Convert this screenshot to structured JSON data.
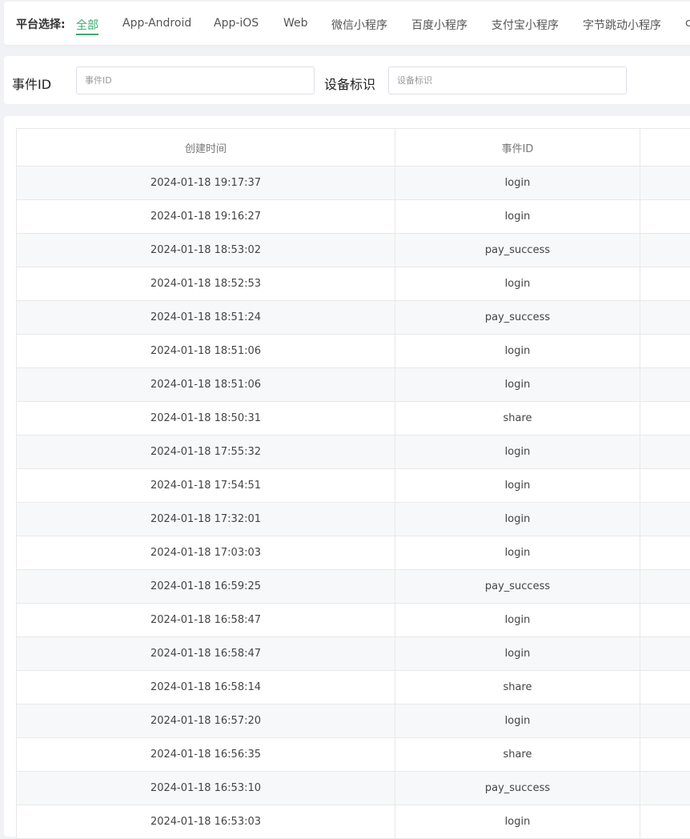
{
  "platform": {
    "label": "平台选择:",
    "tabs": [
      {
        "label": "全部",
        "active": true
      },
      {
        "label": "App-Android",
        "active": false
      },
      {
        "label": "App-iOS",
        "active": false
      },
      {
        "label": "Web",
        "active": false
      },
      {
        "label": "微信小程序",
        "active": false
      },
      {
        "label": "百度小程序",
        "active": false
      },
      {
        "label": "支付宝小程序",
        "active": false
      },
      {
        "label": "字节跳动小程序",
        "active": false
      },
      {
        "label": "c",
        "active": false
      }
    ],
    "accent_color": "#3aaa6f"
  },
  "search": {
    "event_id_label": "事件ID",
    "event_id_placeholder": "事件ID",
    "device_label": "设备标识",
    "device_placeholder": "设备标识"
  },
  "table": {
    "columns": [
      "创建时间",
      "事件ID",
      ""
    ],
    "rows": [
      {
        "time": "2024-01-18 19:17:37",
        "event": "login"
      },
      {
        "time": "2024-01-18 19:16:27",
        "event": "login"
      },
      {
        "time": "2024-01-18 18:53:02",
        "event": "pay_success"
      },
      {
        "time": "2024-01-18 18:52:53",
        "event": "login"
      },
      {
        "time": "2024-01-18 18:51:24",
        "event": "pay_success"
      },
      {
        "time": "2024-01-18 18:51:06",
        "event": "login"
      },
      {
        "time": "2024-01-18 18:51:06",
        "event": "login"
      },
      {
        "time": "2024-01-18 18:50:31",
        "event": "share"
      },
      {
        "time": "2024-01-18 17:55:32",
        "event": "login"
      },
      {
        "time": "2024-01-18 17:54:51",
        "event": "login"
      },
      {
        "time": "2024-01-18 17:32:01",
        "event": "login"
      },
      {
        "time": "2024-01-18 17:03:03",
        "event": "login"
      },
      {
        "time": "2024-01-18 16:59:25",
        "event": "pay_success"
      },
      {
        "time": "2024-01-18 16:58:47",
        "event": "login"
      },
      {
        "time": "2024-01-18 16:58:47",
        "event": "login"
      },
      {
        "time": "2024-01-18 16:58:14",
        "event": "share"
      },
      {
        "time": "2024-01-18 16:57:20",
        "event": "login"
      },
      {
        "time": "2024-01-18 16:56:35",
        "event": "share"
      },
      {
        "time": "2024-01-18 16:53:10",
        "event": "pay_success"
      },
      {
        "time": "2024-01-18 16:53:03",
        "event": "login"
      }
    ]
  }
}
